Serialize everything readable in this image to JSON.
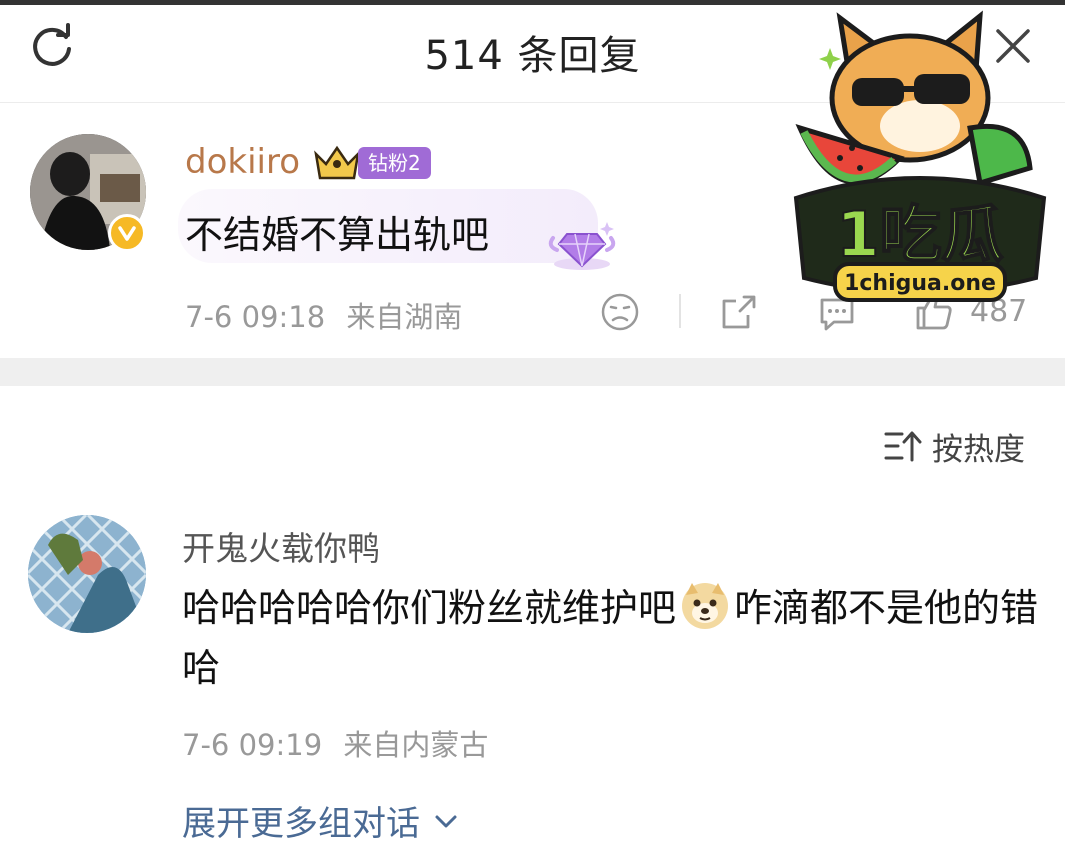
{
  "header": {
    "title": "514 条回复"
  },
  "main_comment": {
    "username": "dokiiro",
    "fan_badge": "钻粉2",
    "text": "不结婚不算出轨吧",
    "timestamp": "7-6 09:18",
    "location": "来自湖南",
    "like_count": "487"
  },
  "sort": {
    "label": "按热度"
  },
  "reply": {
    "username": "开鬼火载你鸭",
    "text_part1": "哈哈哈哈哈你们粉丝就维护吧",
    "text_part2": "咋滴都不是他的错哈",
    "timestamp": "7-6 09:19",
    "location": "来自内蒙古",
    "expand_label": "展开更多组对话"
  },
  "watermark": {
    "brand": "1吃瓜",
    "domain": "1chigua.one"
  },
  "colors": {
    "username_gold": "#b8784a",
    "fan_badge_purple": "#a06bd6",
    "link_blue": "#4a6a94",
    "meta_gray": "#999999"
  }
}
